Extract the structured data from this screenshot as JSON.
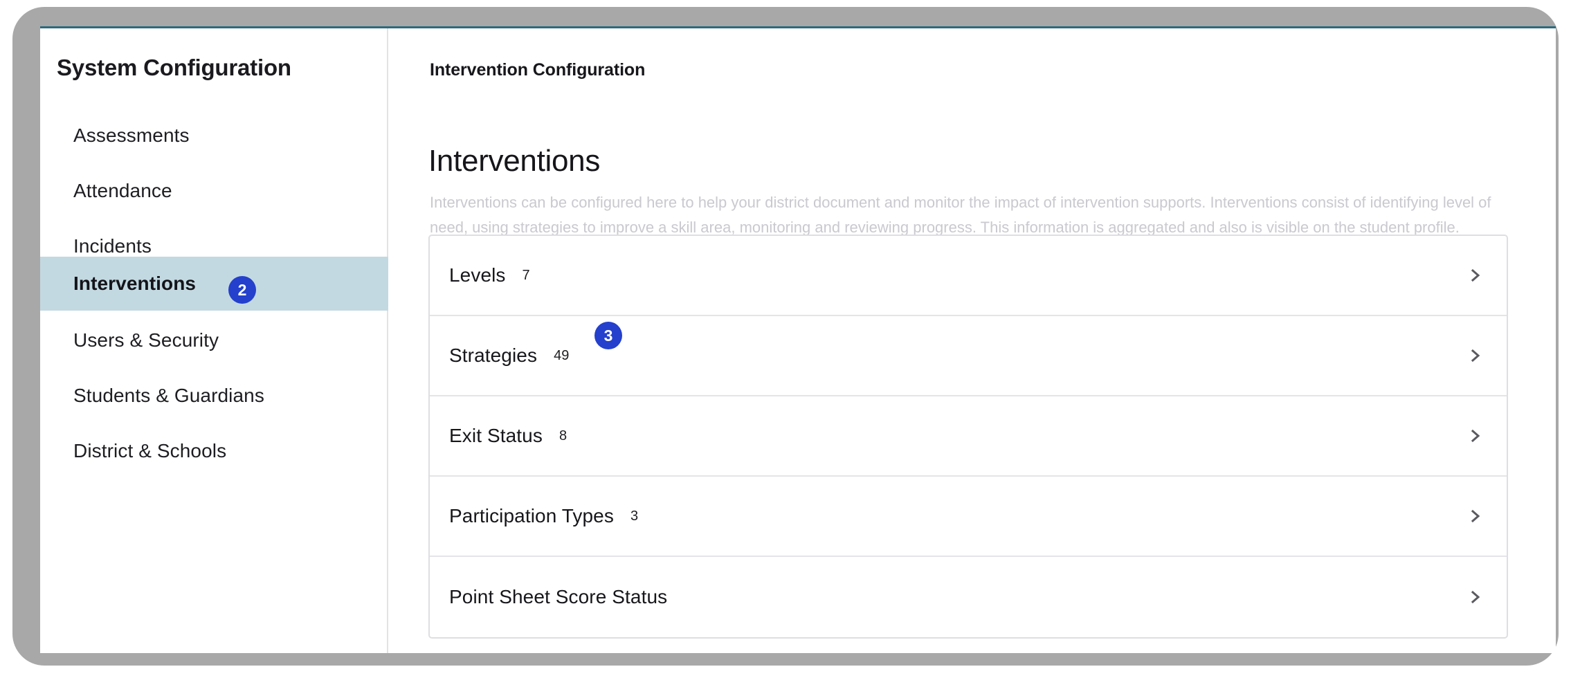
{
  "sidebar": {
    "title": "System Configuration",
    "items": [
      {
        "label": "Assessments",
        "active": false
      },
      {
        "label": "Attendance",
        "active": false
      },
      {
        "label": "Incidents",
        "active": false
      },
      {
        "label": "Interventions",
        "active": true,
        "badge": "2"
      },
      {
        "label": "Users & Security",
        "active": false
      },
      {
        "label": "Students & Guardians",
        "active": false
      },
      {
        "label": "District & Schools",
        "active": false
      }
    ]
  },
  "main": {
    "breadcrumb": "Intervention Configuration",
    "title": "Interventions",
    "description": "Interventions can be configured here to help your district document and monitor the impact of intervention supports. Interventions consist of identifying level of need, using strategies to improve a skill area, monitoring and reviewing progress. This information is aggregated and also is visible on the student profile.",
    "rows": [
      {
        "label": "Levels",
        "count": "7"
      },
      {
        "label": "Strategies",
        "count": "49",
        "badge": "3"
      },
      {
        "label": "Exit Status",
        "count": "8"
      },
      {
        "label": "Participation Types",
        "count": "3"
      },
      {
        "label": "Point Sheet Score Status",
        "count": ""
      }
    ]
  },
  "icons": {
    "chevron_right": "chevron-right-icon"
  },
  "colors": {
    "badge_blue": "#2440cc",
    "active_nav": "#c3d9e1",
    "panel_top_rule": "#2b6a80",
    "frame_gray": "#a8a8a8",
    "card_border": "#dedee3",
    "description_gray": "#c9c9cf"
  }
}
